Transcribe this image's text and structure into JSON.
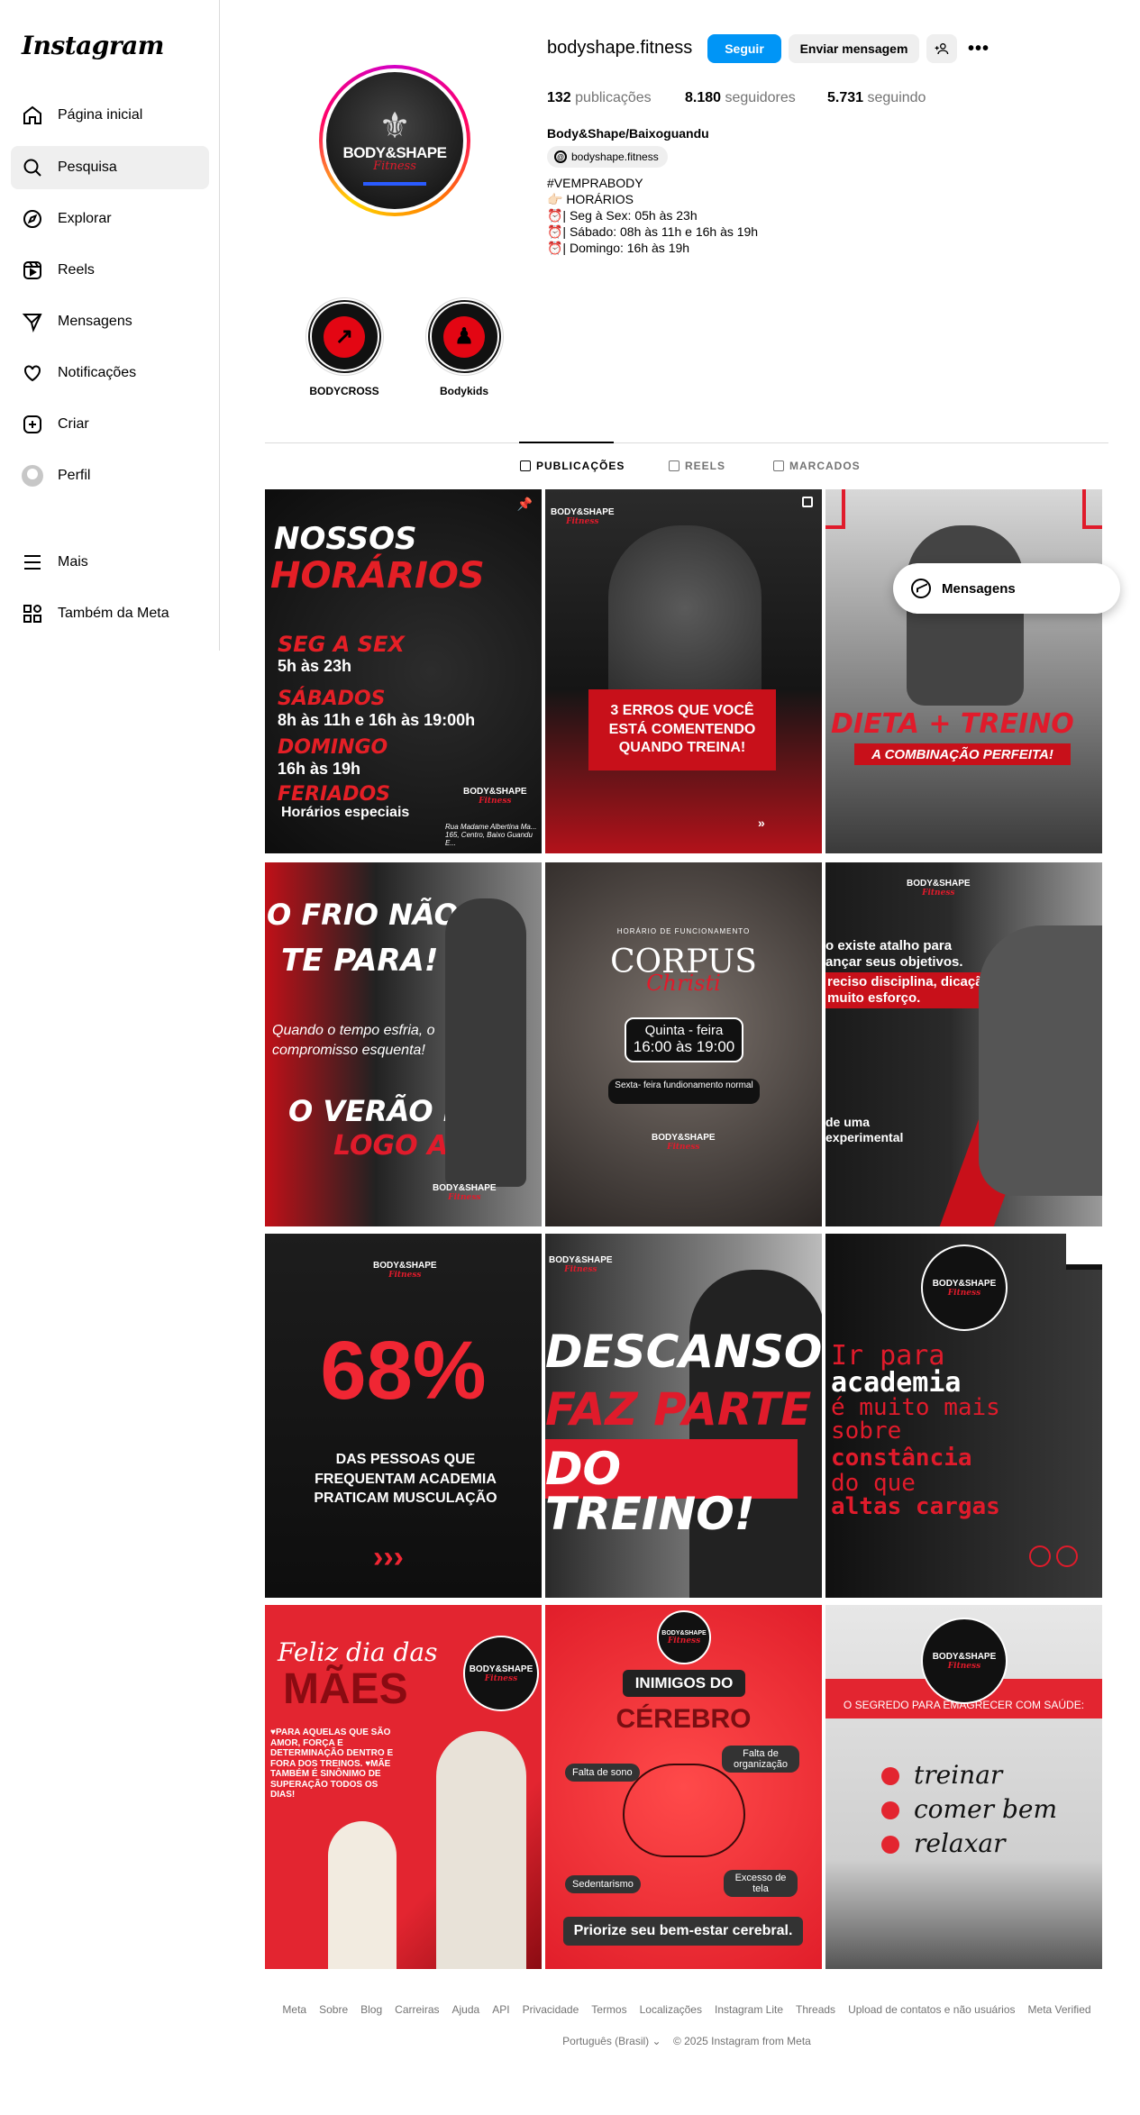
{
  "app": {
    "logo": "Instagram"
  },
  "sidebar": {
    "items": [
      {
        "label": "Página inicial",
        "icon": "home-icon"
      },
      {
        "label": "Pesquisa",
        "icon": "search-icon"
      },
      {
        "label": "Explorar",
        "icon": "compass-icon"
      },
      {
        "label": "Reels",
        "icon": "reels-icon"
      },
      {
        "label": "Mensagens",
        "icon": "paper-plane-icon"
      },
      {
        "label": "Notificações",
        "icon": "heart-icon"
      },
      {
        "label": "Criar",
        "icon": "plus-square-icon"
      },
      {
        "label": "Perfil",
        "icon": "avatar-icon"
      },
      {
        "label": "Mais",
        "icon": "menu-icon"
      },
      {
        "label": "Também da Meta",
        "icon": "grid-icon"
      }
    ]
  },
  "profile": {
    "username": "bodyshape.fitness",
    "follow_label": "Seguir",
    "message_label": "Enviar mensagem",
    "more_label": "•••",
    "avatar": {
      "brand": "BODY&SHAPE",
      "sub": "Fitness"
    },
    "stats": {
      "posts_count": "132",
      "posts_label": "publicações",
      "followers_count": "8.180",
      "followers_label": "seguidores",
      "following_count": "5.731",
      "following_label": "seguindo"
    },
    "full_name": "Body&Shape/Baixoguandu",
    "threads_handle": "bodyshape.fitness",
    "bio": [
      "#VEMPRABODY",
      "👉🏻 HORÁRIOS",
      "⏰| Seg à Sex: 05h às 23h",
      "⏰| Sábado: 08h às 11h e 16h às 19h",
      "⏰| Domingo: 16h às 19h"
    ]
  },
  "highlights": [
    {
      "label": "BODYCROSS"
    },
    {
      "label": "Bodykids"
    }
  ],
  "tabs": [
    {
      "label": "PUBLICAÇÕES",
      "icon": "grid-icon"
    },
    {
      "label": "REELS",
      "icon": "reels-icon"
    },
    {
      "label": "MARCADOS",
      "icon": "tagged-icon"
    }
  ],
  "posts": {
    "p1": {
      "l1": "NOSSOS",
      "l2": "HORÁRIOS",
      "a": "SEG A SEX",
      "a2": "5h às 23h",
      "b": "SÁBADOS",
      "b2": "8h às 11h e 16h às 19:00h",
      "c": "DOMINGO",
      "c2": "16h às 19h",
      "d": "FERIADOS",
      "d2": "Horários especiais",
      "addr": "Rua Madame Albertina Ma... 165, Centro, Baixo Guandu E..."
    },
    "p2": {
      "text": "3 ERROS QUE VOCÊ ESTÁ COMENTENDO QUANDO TREINA!"
    },
    "p3": {
      "l1": "DIETA + TREINO",
      "l2": "A COMBINAÇÃO PERFEITA!"
    },
    "p4": {
      "l1": "O FRIO NÃO",
      "l2": "TE PARA!",
      "l3": "Quando o tempo esfria, o compromisso esquenta!",
      "l4": "O VERÃO É",
      "l5": "LOGO ALI!"
    },
    "p5": {
      "l1": "HORÁRIO DE FUNCIONAMENTO",
      "l2": "CORPUS",
      "l3": "Christi",
      "l4": "Quinta - feira",
      "l5": "16:00 às 19:00",
      "l6": "Sexta- feira fundionamento normal"
    },
    "p6": {
      "l1": "o existe atalho para ançar seus objetivos.",
      "l2": "reciso disciplina, dicação e muito esforço.",
      "l3": "de uma experimental"
    },
    "p7": {
      "l1": "68%",
      "l2": "DAS PESSOAS QUE FREQUENTAM ACADEMIA PRATICAM MUSCULAÇÃO",
      "l3": "›››"
    },
    "p8": {
      "l1": "DESCANSO",
      "l2": "FAZ PARTE",
      "l3": "DO TREINO!"
    },
    "p9": {
      "l1": "Ir para",
      "l2": "academia",
      "l3": "é muito mais sobre",
      "l4": "constância",
      "l5": "do que",
      "l6": "altas cargas"
    },
    "p10": {
      "l1": "Feliz dia das",
      "l2": "MÃES",
      "l3": "♥PARA AQUELAS QUE SÃO AMOR, FORÇA E DETERMINAÇÃO DENTRO E FORA DOS TREINOS. ♥MÃE TAMBÉM É SINÔNIMO DE SUPERAÇÃO TODOS OS DIAS!"
    },
    "p11": {
      "l1": "INIMIGOS DO",
      "l2": "CÉREBRO",
      "a": "Falta de sono",
      "b": "Falta de organização",
      "c": "Sedentarismo",
      "d": "Excesso de tela",
      "l3": "Priorize seu bem-estar cerebral."
    },
    "p12": {
      "l1": "O SEGREDO PARA EMAGRECER COM SAÚDE:",
      "a": "treinar",
      "b": "comer bem",
      "c": "relaxar"
    },
    "logo_brand": "BODY&SHAPE",
    "logo_sub": "Fitness"
  },
  "floating": {
    "messages_label": "Mensagens"
  },
  "footer": {
    "links": [
      "Meta",
      "Sobre",
      "Blog",
      "Carreiras",
      "Ajuda",
      "API",
      "Privacidade",
      "Termos",
      "Localizações",
      "Instagram Lite",
      "Threads",
      "Upload de contatos e não usuários",
      "Meta Verified"
    ],
    "language": "Português (Brasil)",
    "copyright": "© 2025 Instagram from Meta"
  },
  "colors": {
    "accent": "#0095f6",
    "brand_red": "#e01b2b"
  }
}
